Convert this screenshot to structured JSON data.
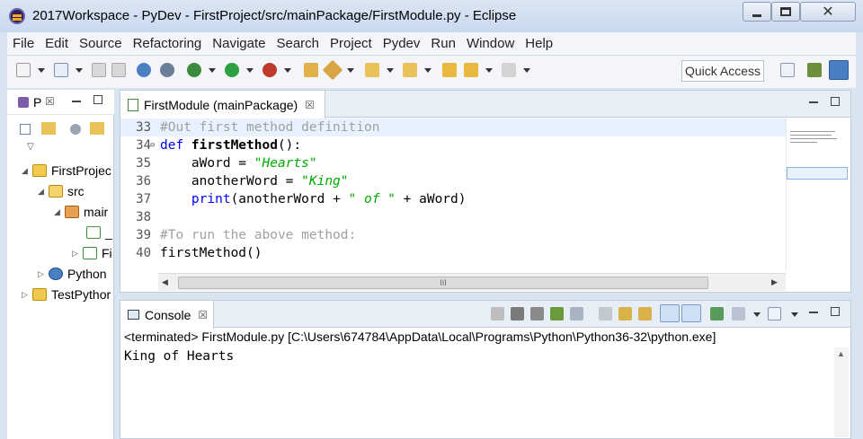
{
  "window": {
    "title": "2017Workspace - PyDev - FirstProject/src/mainPackage/FirstModule.py - Eclipse",
    "close_glyph": "✕"
  },
  "menu": {
    "items": [
      "File",
      "Edit",
      "Source",
      "Refactoring",
      "Navigate",
      "Search",
      "Project",
      "Pydev",
      "Run",
      "Window",
      "Help"
    ]
  },
  "toolbar": {
    "quick_access_label": "Quick Access"
  },
  "explorer": {
    "tab_label": "P",
    "tab_close": "☒",
    "tree": [
      {
        "label": "FirstProjec",
        "twisty": "◢"
      },
      {
        "label": "src",
        "twisty": "◢"
      },
      {
        "label": "mair",
        "twisty": "◢"
      },
      {
        "label": "_",
        "twisty": ""
      },
      {
        "label": "Fi",
        "twisty": "▷"
      },
      {
        "label": "Python",
        "twisty": "▷"
      },
      {
        "label": "TestPythor",
        "twisty": "▷"
      }
    ]
  },
  "editor": {
    "tab_label": "FirstModule (mainPackage)",
    "tab_close": "☒",
    "fold_glyph": "⊖",
    "hscroll_grip": "III",
    "lines": [
      {
        "num": "33",
        "text": "#Out first method definition"
      },
      {
        "num": "34",
        "kw": "def ",
        "fn": "firstMethod",
        "rest": "():"
      },
      {
        "num": "35",
        "pre": "    aWord = ",
        "str": "\"Hearts\""
      },
      {
        "num": "36",
        "pre": "    anotherWord = ",
        "str": "\"King\""
      },
      {
        "num": "37",
        "indent": "    ",
        "builtin": "print",
        "mid": "(anotherWord + ",
        "str": "\" of \"",
        "post": " + aWord)"
      },
      {
        "num": "38",
        "text": ""
      },
      {
        "num": "39",
        "text": "#To run the above method:"
      },
      {
        "num": "40",
        "text": "firstMethod()"
      }
    ]
  },
  "console": {
    "tab_label": "Console",
    "tab_close": "☒",
    "status": "<terminated> FirstModule.py [C:\\Users\\674784\\AppData\\Local\\Programs\\Python\\Python36-32\\python.exe]",
    "output": "King of Hearts"
  },
  "colors": {
    "keyword": "#0000ff",
    "string": "#00aa00",
    "comment": "#a0a0a0",
    "current_line": "#e8f2fe"
  }
}
